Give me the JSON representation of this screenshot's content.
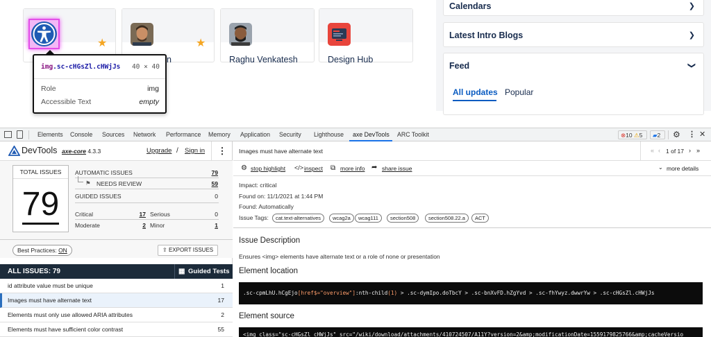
{
  "cards": [
    {
      "name": ""
    },
    {
      "name": ""
    },
    {
      "name": "Raghu Venkatesh"
    },
    {
      "name": "Design Hub"
    }
  ],
  "tooltip": {
    "selector_tag": "img",
    "selector_class": ".sc-cHGsZl.cHWjJs",
    "dims": "40 × 40",
    "truncated_text": "n",
    "role_label": "Role",
    "role_value": "img",
    "name_label": "Accessible Text",
    "name_value": "empty"
  },
  "right_panel": {
    "calendars": "Calendars",
    "intro_blogs": "Latest Intro Blogs",
    "feed": "Feed",
    "feed_tabs": [
      "All updates",
      "Popular"
    ]
  },
  "devtools_tabs": [
    "Elements",
    "Console",
    "Sources",
    "Network",
    "Performance",
    "Memory",
    "Application",
    "Security",
    "Lighthouse",
    "axe DevTools",
    "ARC Toolkit"
  ],
  "devtools_badges": {
    "errors": "10",
    "warnings": "5",
    "messages": "2"
  },
  "axe": {
    "brand": "DevTools",
    "core_label": "axe-core",
    "core_version": "4.3.3",
    "upgrade": "Upgrade",
    "slash": "/",
    "sign_in": "Sign in",
    "total_label": "TOTAL ISSUES",
    "total": "79",
    "automatic_label": "AUTOMATIC ISSUES",
    "automatic": "79",
    "needs_review_label": "NEEDS REVIEW",
    "needs_review": "59",
    "guided_label": "GUIDED ISSUES",
    "guided": "0",
    "critical_label": "Critical",
    "critical": "17",
    "serious_label": "Serious",
    "serious": "0",
    "moderate_label": "Moderate",
    "moderate": "2",
    "minor_label": "Minor",
    "minor": "1",
    "best_practices_label": "Best Practices:",
    "best_practices_value": "ON",
    "export_label": "EXPORT ISSUES",
    "all_issues_label": "ALL ISSUES:",
    "all_issues": "79",
    "guided_tests": "Guided Tests",
    "issues": [
      {
        "name": "id attribute value must be unique",
        "count": "1"
      },
      {
        "name": "Images must have alternate text",
        "count": "17"
      },
      {
        "name": "Elements must only use allowed ARIA attributes",
        "count": "2"
      },
      {
        "name": "Elements must have sufficient color contrast",
        "count": "55"
      }
    ]
  },
  "detail": {
    "title": "Images must have alternate text",
    "pager": "1 of 17",
    "actions": {
      "stop_highlight": "stop highlight",
      "inspect": "inspect",
      "more_info": "more info",
      "share_issue": "share issue",
      "more_details": "more details"
    },
    "impact_label": "Impact:",
    "impact": "critical",
    "found_on_label": "Found on:",
    "found_on": "11/1/2021 at 1:44 PM",
    "found_label": "Found:",
    "found": "Automatically",
    "tags_label": "Issue Tags:",
    "tags": [
      "cat.text-alternatives",
      "wcag2a",
      "wcag111",
      "section508",
      "section508.22.a",
      "ACT"
    ],
    "description_heading": "Issue Description",
    "description": "Ensures <img> elements have alternate text or a role of none or presentation",
    "location_heading": "Element location",
    "location_code_1": ".sc-cpmLhU.hCgEjo",
    "location_code_attr": "[href$=\"overview\"]",
    "location_code_2": ":nth-child",
    "location_code_num": "(1)",
    "location_code_3": " > .sc-dymIpo.doTbcY > .sc-bnXvFD.hZgYvd > .sc-fhYwyz.dwwrYw > .sc-cHGsZl.cHWjJs",
    "source_heading": "Element source",
    "source_code": "<img class=\"sc-cHGsZl cHWjJs\" src=\"/wiki/download/attachments/410724507/A11Y?version=2&amp;modificationDate=1559179825766&amp;cacheVersio"
  },
  "colors": {
    "accent": "#1a73e8",
    "star": "#f5a623",
    "highlight": "#e34ee8",
    "dark_bar": "#1c2b3a"
  }
}
